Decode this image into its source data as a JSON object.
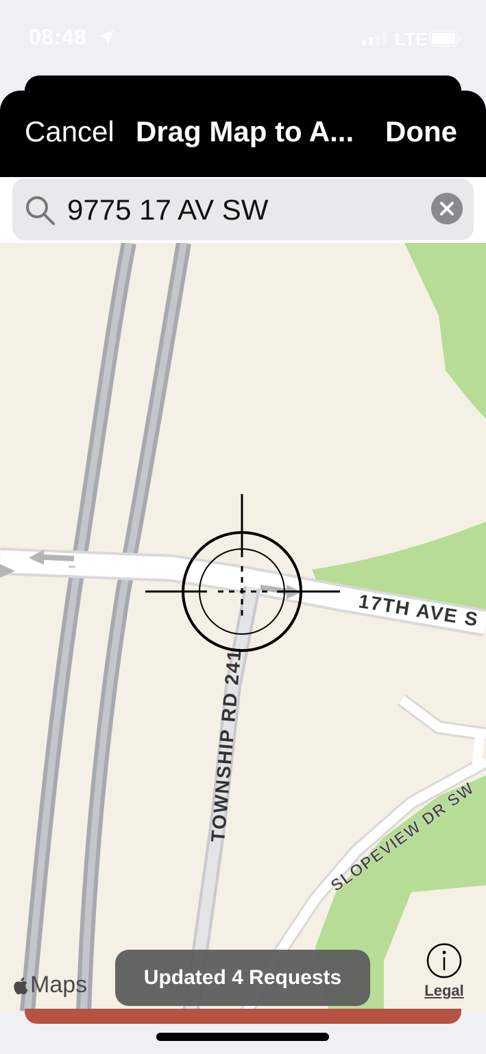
{
  "status_bar": {
    "time": "08:48",
    "network": "LTE"
  },
  "nav": {
    "cancel_label": "Cancel",
    "title": "Drag Map to A...",
    "done_label": "Done"
  },
  "search": {
    "value": "9775 17 AV SW"
  },
  "map": {
    "street_labels": [
      "17TH AVE S",
      "TOWNSHIP RD 241",
      "SLOPEVIEW DR SW"
    ],
    "attribution": "Maps",
    "legal_label": "Legal"
  },
  "toast": {
    "message": "Updated 4 Requests"
  },
  "colors": {
    "nav_bg": "#000000",
    "toast_bg": "#5a5a5a",
    "bottom_accent": "#b75343",
    "park_green": "#b7dc95",
    "land": "#f5f0e6"
  },
  "icons": [
    "location-arrow-icon",
    "signal-icon",
    "battery-icon",
    "search-icon",
    "clear-icon",
    "crosshair-icon",
    "info-icon",
    "apple-logo-icon"
  ]
}
